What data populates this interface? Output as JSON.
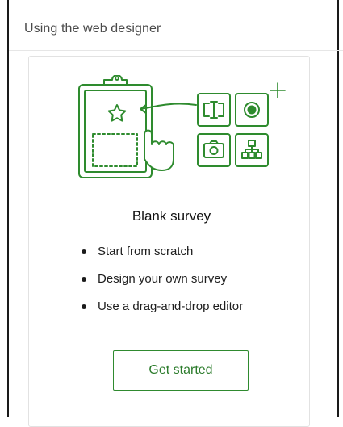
{
  "panel": {
    "title": "Using the web designer"
  },
  "card": {
    "title": "Blank survey",
    "features": [
      "Start from scratch",
      "Design your own survey",
      "Use a drag-and-drop editor"
    ],
    "cta_label": "Get started"
  },
  "colors": {
    "accent": "#2e8b2e",
    "border": "#e2e2e2"
  },
  "icons": [
    "clipboard-icon",
    "star-icon",
    "hand-pointer-icon",
    "arrow-icon",
    "text-field-icon",
    "radio-button-icon",
    "plus-icon",
    "camera-icon",
    "hierarchy-icon"
  ]
}
